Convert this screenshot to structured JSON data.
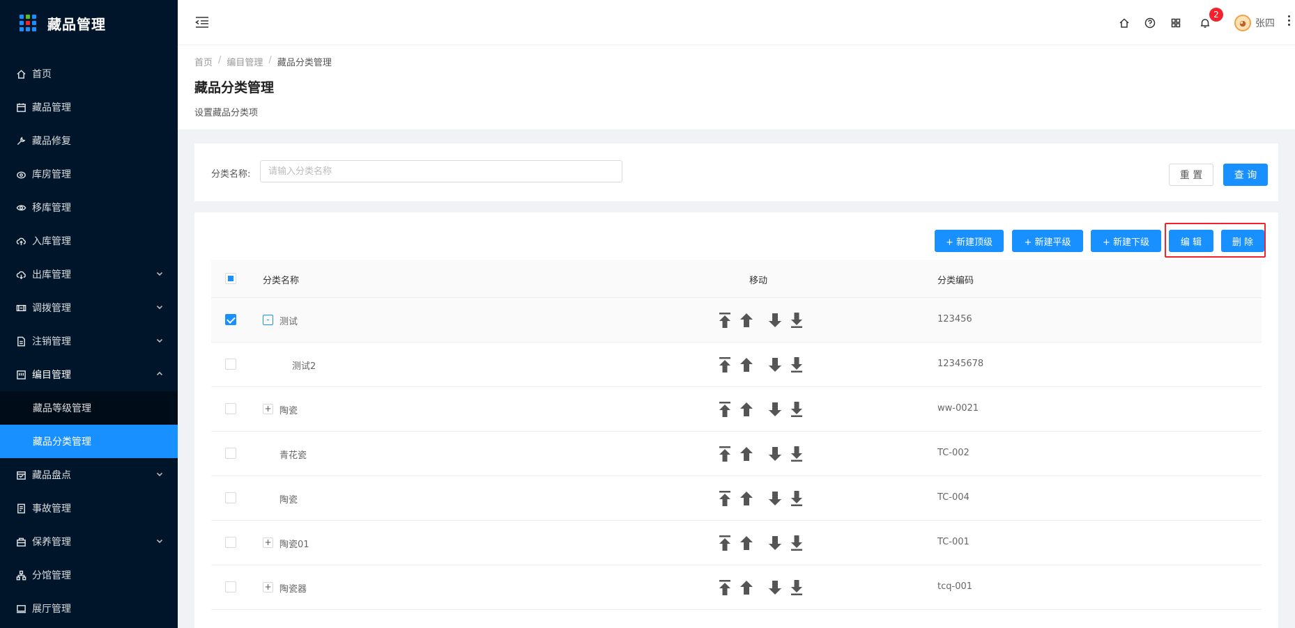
{
  "app": {
    "title": "藏品管理"
  },
  "sidebar": {
    "items": [
      {
        "label": "首页",
        "icon": "home-icon"
      },
      {
        "label": "藏品管理",
        "icon": "calendar-icon"
      },
      {
        "label": "藏品修复",
        "icon": "wrench-icon"
      },
      {
        "label": "库房管理",
        "icon": "warehouse-icon"
      },
      {
        "label": "移库管理",
        "icon": "eye-icon"
      },
      {
        "label": "入库管理",
        "icon": "upload-cloud-icon"
      },
      {
        "label": "出库管理",
        "icon": "download-cloud-icon",
        "has_arrow": true
      },
      {
        "label": "调拨管理",
        "icon": "transfer-icon",
        "has_arrow": true
      },
      {
        "label": "注销管理",
        "icon": "file-icon",
        "has_arrow": true
      },
      {
        "label": "编目管理",
        "icon": "catalog-icon",
        "open": true
      },
      {
        "label": "藏品盘点",
        "icon": "inventory-icon",
        "has_arrow": true
      },
      {
        "label": "事故管理",
        "icon": "report-icon"
      },
      {
        "label": "保养管理",
        "icon": "maintenance-icon",
        "has_arrow": true
      },
      {
        "label": "分馆管理",
        "icon": "branch-icon"
      },
      {
        "label": "展厅管理",
        "icon": "hall-icon"
      }
    ],
    "submenu": [
      {
        "label": "藏品等级管理"
      },
      {
        "label": "藏品分类管理",
        "active": true
      }
    ]
  },
  "header": {
    "notification_count": "2",
    "username": "张四"
  },
  "breadcrumb": [
    "首页",
    "编目管理",
    "藏品分类管理"
  ],
  "page": {
    "title": "藏品分类管理",
    "description": "设置藏品分类项"
  },
  "search": {
    "label": "分类名称:",
    "placeholder": "请输入分类名称",
    "value": "",
    "reset_label": "重 置",
    "query_label": "查 询"
  },
  "toolbar": {
    "new_top": "+ 新建顶级",
    "new_sibling": "+ 新建平级",
    "new_child": "+ 新建下级",
    "edit": "编 辑",
    "delete": "删 除"
  },
  "table": {
    "columns": [
      "分类名称",
      "移动",
      "分类编码"
    ],
    "rows": [
      {
        "name": "测试",
        "code": "123456",
        "checked": true,
        "expander": "-",
        "level": 0
      },
      {
        "name": "测试2",
        "code": "12345678",
        "checked": false,
        "expander": "",
        "level": 1
      },
      {
        "name": "陶瓷",
        "code": "ww-0021",
        "checked": false,
        "expander": "+",
        "level": 0
      },
      {
        "name": "青花瓷",
        "code": "TC-002",
        "checked": false,
        "expander": "",
        "level": 0
      },
      {
        "name": "陶瓷",
        "code": "TC-004",
        "checked": false,
        "expander": "",
        "level": 0
      },
      {
        "name": "陶瓷01",
        "code": "TC-001",
        "checked": false,
        "expander": "+",
        "level": 0
      },
      {
        "name": "陶瓷器",
        "code": "tcq-001",
        "checked": false,
        "expander": "+",
        "level": 0
      }
    ]
  },
  "colors": {
    "sidebar_bg": "#001529",
    "accent": "#1890ff",
    "highlight": "#f5222d"
  }
}
